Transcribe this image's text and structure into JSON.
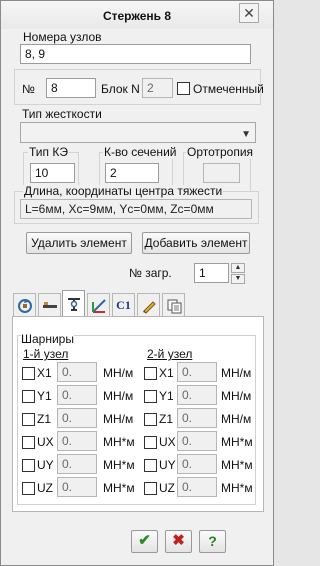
{
  "window": {
    "title": "Стержень  8",
    "close": "✕"
  },
  "nodes": {
    "label": "Номера узлов",
    "value": "8, 9"
  },
  "element": {
    "num_label": "№",
    "num_value": "8",
    "block_label": "Блок N",
    "block_value": "2",
    "marked_label": "Отмеченный"
  },
  "stiffness": {
    "label": "Тип жесткости",
    "value": ""
  },
  "fe_type": {
    "label": "Тип КЭ",
    "value": "10"
  },
  "sections": {
    "label": "К-во сечений",
    "value": "2"
  },
  "orthotropy": {
    "label": "Ортотропия",
    "value": ""
  },
  "length": {
    "label": "Длина, координаты центра тяжести",
    "value": "L=6мм, Xc=9мм, Yc=0мм, Zc=0мм"
  },
  "buttons": {
    "delete": "Удалить элемент",
    "add": "Добавить элемент",
    "ok": "✔",
    "cancel": "✖",
    "help": "?"
  },
  "load": {
    "label": "№ загр.",
    "value": "1"
  },
  "tabs": [
    "rotate-tab-icon",
    "beam-tab-icon",
    "hinge-tab-icon",
    "axes-tab-icon",
    "c1-tab",
    "pencil-tab-icon",
    "copy-tab-icon"
  ],
  "tab_c1_label": "C1",
  "hinges": {
    "title": "Шарниры",
    "node1_label": "1-й узел",
    "node2_label": "2-й узел",
    "rows": [
      {
        "name": "X1",
        "value": "0.",
        "unit": "МН/м"
      },
      {
        "name": "Y1",
        "value": "0.",
        "unit": "МН/м"
      },
      {
        "name": "Z1",
        "value": "0.",
        "unit": "МН/м"
      },
      {
        "name": "UX",
        "value": "0.",
        "unit": "МН*м"
      },
      {
        "name": "UY",
        "value": "0.",
        "unit": "МН*м"
      },
      {
        "name": "UZ",
        "value": "0.",
        "unit": "МН*м"
      }
    ]
  }
}
